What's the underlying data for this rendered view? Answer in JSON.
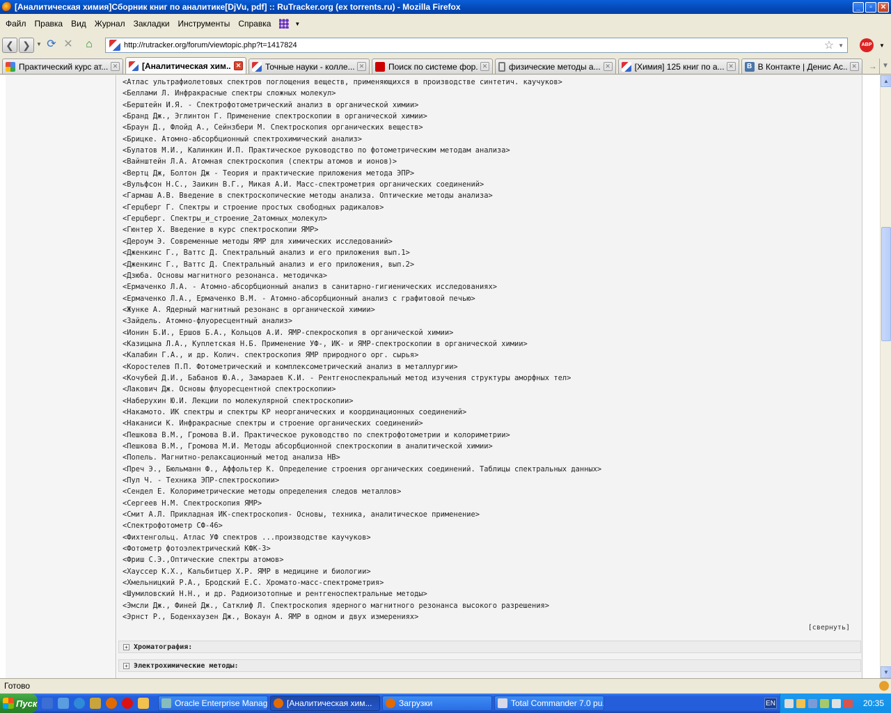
{
  "window": {
    "title": "[Аналитическая химия]Сборник книг по аналитике[DjVu, pdf] :: RuTracker.org (ex torrents.ru) - Mozilla Firefox",
    "minimize": "_",
    "maximize": "▫",
    "close": "✕"
  },
  "menu": [
    "Файл",
    "Правка",
    "Вид",
    "Журнал",
    "Закладки",
    "Инструменты",
    "Справка"
  ],
  "nav": {
    "url": "http://rutracker.org/forum/viewtopic.php?t=1417824",
    "back_icon": "arrow-left-icon",
    "forward_icon": "arrow-right-icon",
    "reload_icon": "reload-icon",
    "stop_icon": "stop-icon",
    "home_icon": "home-icon",
    "abp_label": "ABP"
  },
  "tabs": [
    {
      "label": "Практический курс ат...",
      "icon": "google-icon",
      "active": false
    },
    {
      "label": "[Аналитическая хим...",
      "icon": "rutracker-icon",
      "active": true
    },
    {
      "label": "Точные науки - колле...",
      "icon": "rutracker-icon",
      "active": false
    },
    {
      "label": "Поиск по системе фор...",
      "icon": "yandex-icon",
      "active": false
    },
    {
      "label": "физические методы а...",
      "icon": "paperclip-icon",
      "active": false
    },
    {
      "label": "[Химия] 125 книг по а...",
      "icon": "rutracker-icon",
      "active": false
    },
    {
      "label": "В Контакте | Денис Ас...",
      "icon": "vk-icon",
      "active": false
    }
  ],
  "post": {
    "books": [
      "<Атлас ультрафиолетовых спектров поглощения веществ, применяющихся в производстве синтетич. каучуков>",
      "<Беллами Л. Инфракрасные спектры сложных молекул>",
      "<Берштейн И.Я. - Спектрофотометрический анализ в органической химии>",
      "<Бранд Дж., Эглинтон Г. Применение спектроскопии в органической химии>",
      "<Браун Д., Флойд А., Сейнзбери М. Спектроскопия органических веществ>",
      "<Брицке. Атомно-абсорбционный спектрохимический анализ>",
      "<Булатов М.И., Калинкин И.П. Практическое руководство по фотометрическим методам анализа>",
      "<Вайнштейн Л.А. Атомная спектроскопия (спектры атомов и ионов)>",
      "<Вертц Дж, Болтон Дж - Теория и практические приложения метода ЭПР>",
      "<Вульфсон Н.С., Заикин В.Г., Микая А.И. Масс-спектрометрия органических соединений>",
      "<Гармаш А.В. Введение в спектроскопические методы анализа. Оптические методы анализа>",
      "<Герцберг Г. Спектры и строение простых свободных радикалов>",
      "<Герцберг. Спектры_и_строение_2атомных_молекул>",
      "<Гюнтер Х. Введение в курс спектроскопии ЯМР>",
      "<Дероум Э. Современные методы ЯМР для химических исследований>",
      "<Дженкинс Г., Ваттс Д. Спектральный анализ и его приложения вып.1>",
      "<Дженкинс Г., Ваттс Д. Спектральный анализ и его приложения, вып.2>",
      "<Дзюба. Основы магнитного резонанса. методичка>",
      "<Ермаченко Л.А. - Атомно-абсорбционный анализ в санитарно-гигиенических исследованиях>",
      "<Ермаченко Л.А., Ермаченко В.М. - Атомно-абсорбционный анализ с графитовой печью>",
      "<Жунке А. Ядерный магнитный резонанс в органической химии>",
      "<Зайдель. Атомно-флуоресцентный анализ>",
      "<Ионин Б.И., Ершов Б.А., Кольцов А.И. ЯМР-спекроскопия в органической химии>",
      "<Казицына Л.А., Куплетская Н.Б. Применение УФ-, ИК- и ЯМР-спектроскопии в органической химии>",
      "<Калабин Г.А., и др. Колич. спектроскопия ЯМР природного орг. сырья>",
      "<Коростелев П.П. Фотометрический и комплексометрический анализ в металлургии>",
      "<Кочубей Д.И., Бабанов Ю.А., Замараев К.И. - Рентгеноспекральный метод изучения структуры аморфных тел>",
      "<Лакович Дж. Основы флуоресцентной спектроскопии>",
      "<Наберухин Ю.И. Лекции по молекулярной спектроскопии>",
      "<Накамото. ИК спектры и спектры КР неорганических и координационных соединений>",
      "<Наканиси К. Инфракрасные спектры и строение органических соединений>",
      "<Пешкова В.М., Громова В.И. Практическое руководство по спектрофотометрии и колориметрии>",
      "<Пешкова В.М., Громова М.И. Методы абсорбционной спектроскопии в аналитической химии>",
      "<Попель. Магнитно-релаксационный метод анализа НВ>",
      "<Преч Э., Бюльманн Ф., Аффольтер К. Определение строения органических соединений. Таблицы спектральных данных>",
      "<Пул Ч. - Техника ЭПР-спектроскопии>",
      "<Сендел Е. Колориметрические методы определения следов металлов>",
      "<Сергеев Н.М. Спектроскопия ЯМР>",
      "<Смит А.Л. Прикладная ИК-спектроскопия- Основы, техника, аналитическое применение>",
      "<Спектрофотометр СФ-46>",
      "<Фихтенгольц. Атлас УФ спектров ...производстве каучуков>",
      "<Фотометр фотоэлектрический КФК-3>",
      "<Фриш С.Э.,Оптические спектры атомов>",
      "<Хауссер К.Х., Кальбитцер Х.Р. ЯМР в медицине и биологии>",
      "<Хмельницкий Р.А., Бродский Е.С. Хромато-масс-спектрометрия>",
      "<Шумиловский Н.Н., и др. Радиоизотопные и рентгеноспектральные методы>",
      "<Эмсли Дж., Финей Дж., Сатклиф Л. Спектроскопия ядерного магнитного резонанса высокого разрешения>",
      "<Эрнст Р., Боденхаузен Дж., Вокаун А. ЯМР в одном и двух измерениях>"
    ],
    "collapse_label": "[свернуть]",
    "spoilers": [
      {
        "label": "Хроматография:"
      },
      {
        "label": "Электрохимические методы:"
      }
    ]
  },
  "status": {
    "text": "Готово"
  },
  "taskbar": {
    "start_label": "Пуск",
    "tasks": [
      {
        "label": "Oracle Enterprise Manag...",
        "active": false
      },
      {
        "label": "[Аналитическая хим...",
        "active": true
      },
      {
        "label": "Загрузки",
        "active": false
      },
      {
        "label": "Total Commander 7.0 pu...",
        "active": false
      }
    ],
    "lang": "EN",
    "clock": "20:35"
  },
  "colors": {
    "titlebar": "#0549b7",
    "taskbar": "#245edb",
    "start_button": "#2f8f2f",
    "post_background": "#f3f3f3"
  }
}
